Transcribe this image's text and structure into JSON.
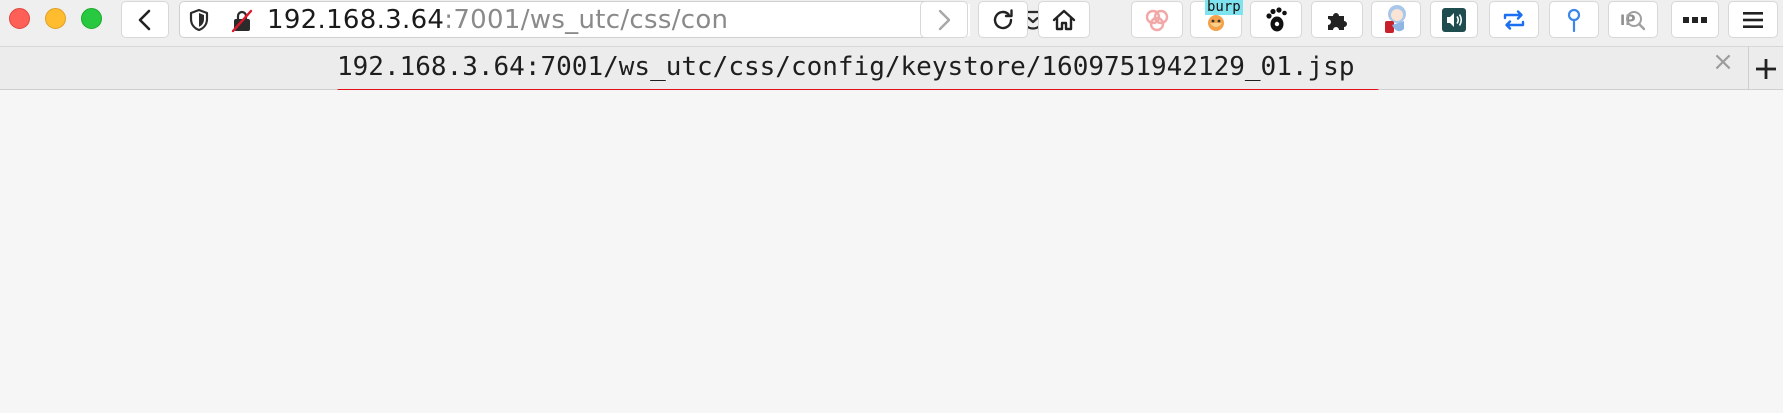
{
  "urlbar": {
    "host": "192.168.3.64",
    "rest": ":7001/ws_utc/css/con"
  },
  "tab": {
    "title": "192.168.3.64:7001/ws_utc/css/config/keystore/1609751942129_01.jsp",
    "close_glyph": "×"
  },
  "extensions": {
    "burp_label": "burp"
  },
  "colors": {
    "highlight_underline": "#e3101a",
    "burp_badge": "#7fe3ef"
  },
  "icons": [
    "back-icon",
    "shield-icon",
    "insecure-lock-icon",
    "more-icon",
    "pocket-icon",
    "star-icon",
    "forward-icon",
    "reload-icon",
    "home-icon",
    "knot-extension-icon",
    "burp-fox-icon",
    "gnome-foot-icon",
    "puzzle-icon",
    "anime-avatar-icon",
    "speaker-icon",
    "sync-icon",
    "pin-icon",
    "ip-search-icon",
    "overflow-icon",
    "hamburger-menu-icon",
    "plus-icon"
  ]
}
